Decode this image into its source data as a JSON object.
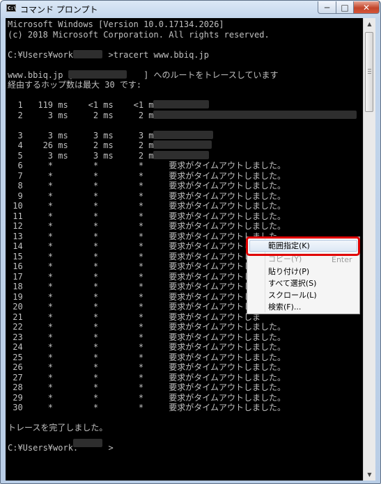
{
  "window": {
    "title": "コマンド プロンプト",
    "icon_label": "C:\\",
    "controls": {
      "minimize": "─",
      "maximize": "□",
      "close": "✕"
    }
  },
  "console": {
    "lines": [
      "Microsoft Windows [Version 10.0.17134.2026]",
      "(c) 2018 Microsoft Corporation. All rights reserved.",
      "",
      "C:¥Users¥work.      >tracert www.bbiq.jp",
      "",
      "www.bbiq.jp [              ] へのルートをトレースしています",
      "経由するホップ数は最大 30 です:",
      "",
      "  1   119 ms    <1 ms    <1 ms",
      "  2     3 ms     2 ms     2 ms",
      "",
      "  3     3 ms     3 ms     3 ms",
      "  4    26 ms     2 ms     2 ms",
      "  5     3 ms     3 ms     2 ms",
      "  6     *        *        *     要求がタイムアウトしました。",
      "  7     *        *        *     要求がタイムアウトしました。",
      "  8     *        *        *     要求がタイムアウトしました。",
      "  9     *        *        *     要求がタイムアウトしました。",
      " 10     *        *        *     要求がタイムアウトしました。",
      " 11     *        *        *     要求がタイムアウトしました。",
      " 12     *        *        *     要求がタイムアウトしました。",
      " 13     *        *        *     要求がタイムアウトしました。",
      " 14     *        *        *     要求がタイムアウトしま",
      " 15     *        *        *     要求がタイムアウトしま",
      " 16     *        *        *     要求がタイムアウトしま",
      " 17     *        *        *     要求がタイムアウトしま",
      " 18     *        *        *     要求がタイムアウトしま",
      " 19     *        *        *     要求がタイムアウトしま",
      " 20     *        *        *     要求がタイムアウトしま",
      " 21     *        *        *     要求がタイムアウトしま",
      " 22     *        *        *     要求がタイムアウトしました。",
      " 23     *        *        *     要求がタイムアウトしました。",
      " 24     *        *        *     要求がタイムアウトしました。",
      " 25     *        *        *     要求がタイムアウトしました。",
      " 26     *        *        *     要求がタイムアウトしました。",
      " 27     *        *        *     要求がタイムアウトしました。",
      " 28     *        *        *     要求がタイムアウトしました。",
      " 29     *        *        *     要求がタイムアウトしました。",
      " 30     *        *        *     要求がタイムアウトしました。",
      "",
      "トレースを完了しました。",
      "",
      "C:¥Users¥work.      >"
    ]
  },
  "context_menu": {
    "items": [
      {
        "label": "範囲指定(K)",
        "enabled": true
      },
      {
        "label": "コピー(Y)",
        "shortcut": "Enter",
        "enabled": false
      },
      {
        "label": "貼り付け(P)",
        "enabled": true
      },
      {
        "label": "すべて選択(S)",
        "enabled": true
      },
      {
        "label": "スクロール(L)",
        "enabled": true
      },
      {
        "label": "検索(F)...",
        "enabled": true
      }
    ]
  },
  "colors": {
    "console_bg": "#000000",
    "console_fg": "#c0c0c0",
    "highlight": "#e00000",
    "close_button": "#c2462b"
  },
  "scrollbar": {
    "up_icon": "▲",
    "down_icon": "▼"
  }
}
